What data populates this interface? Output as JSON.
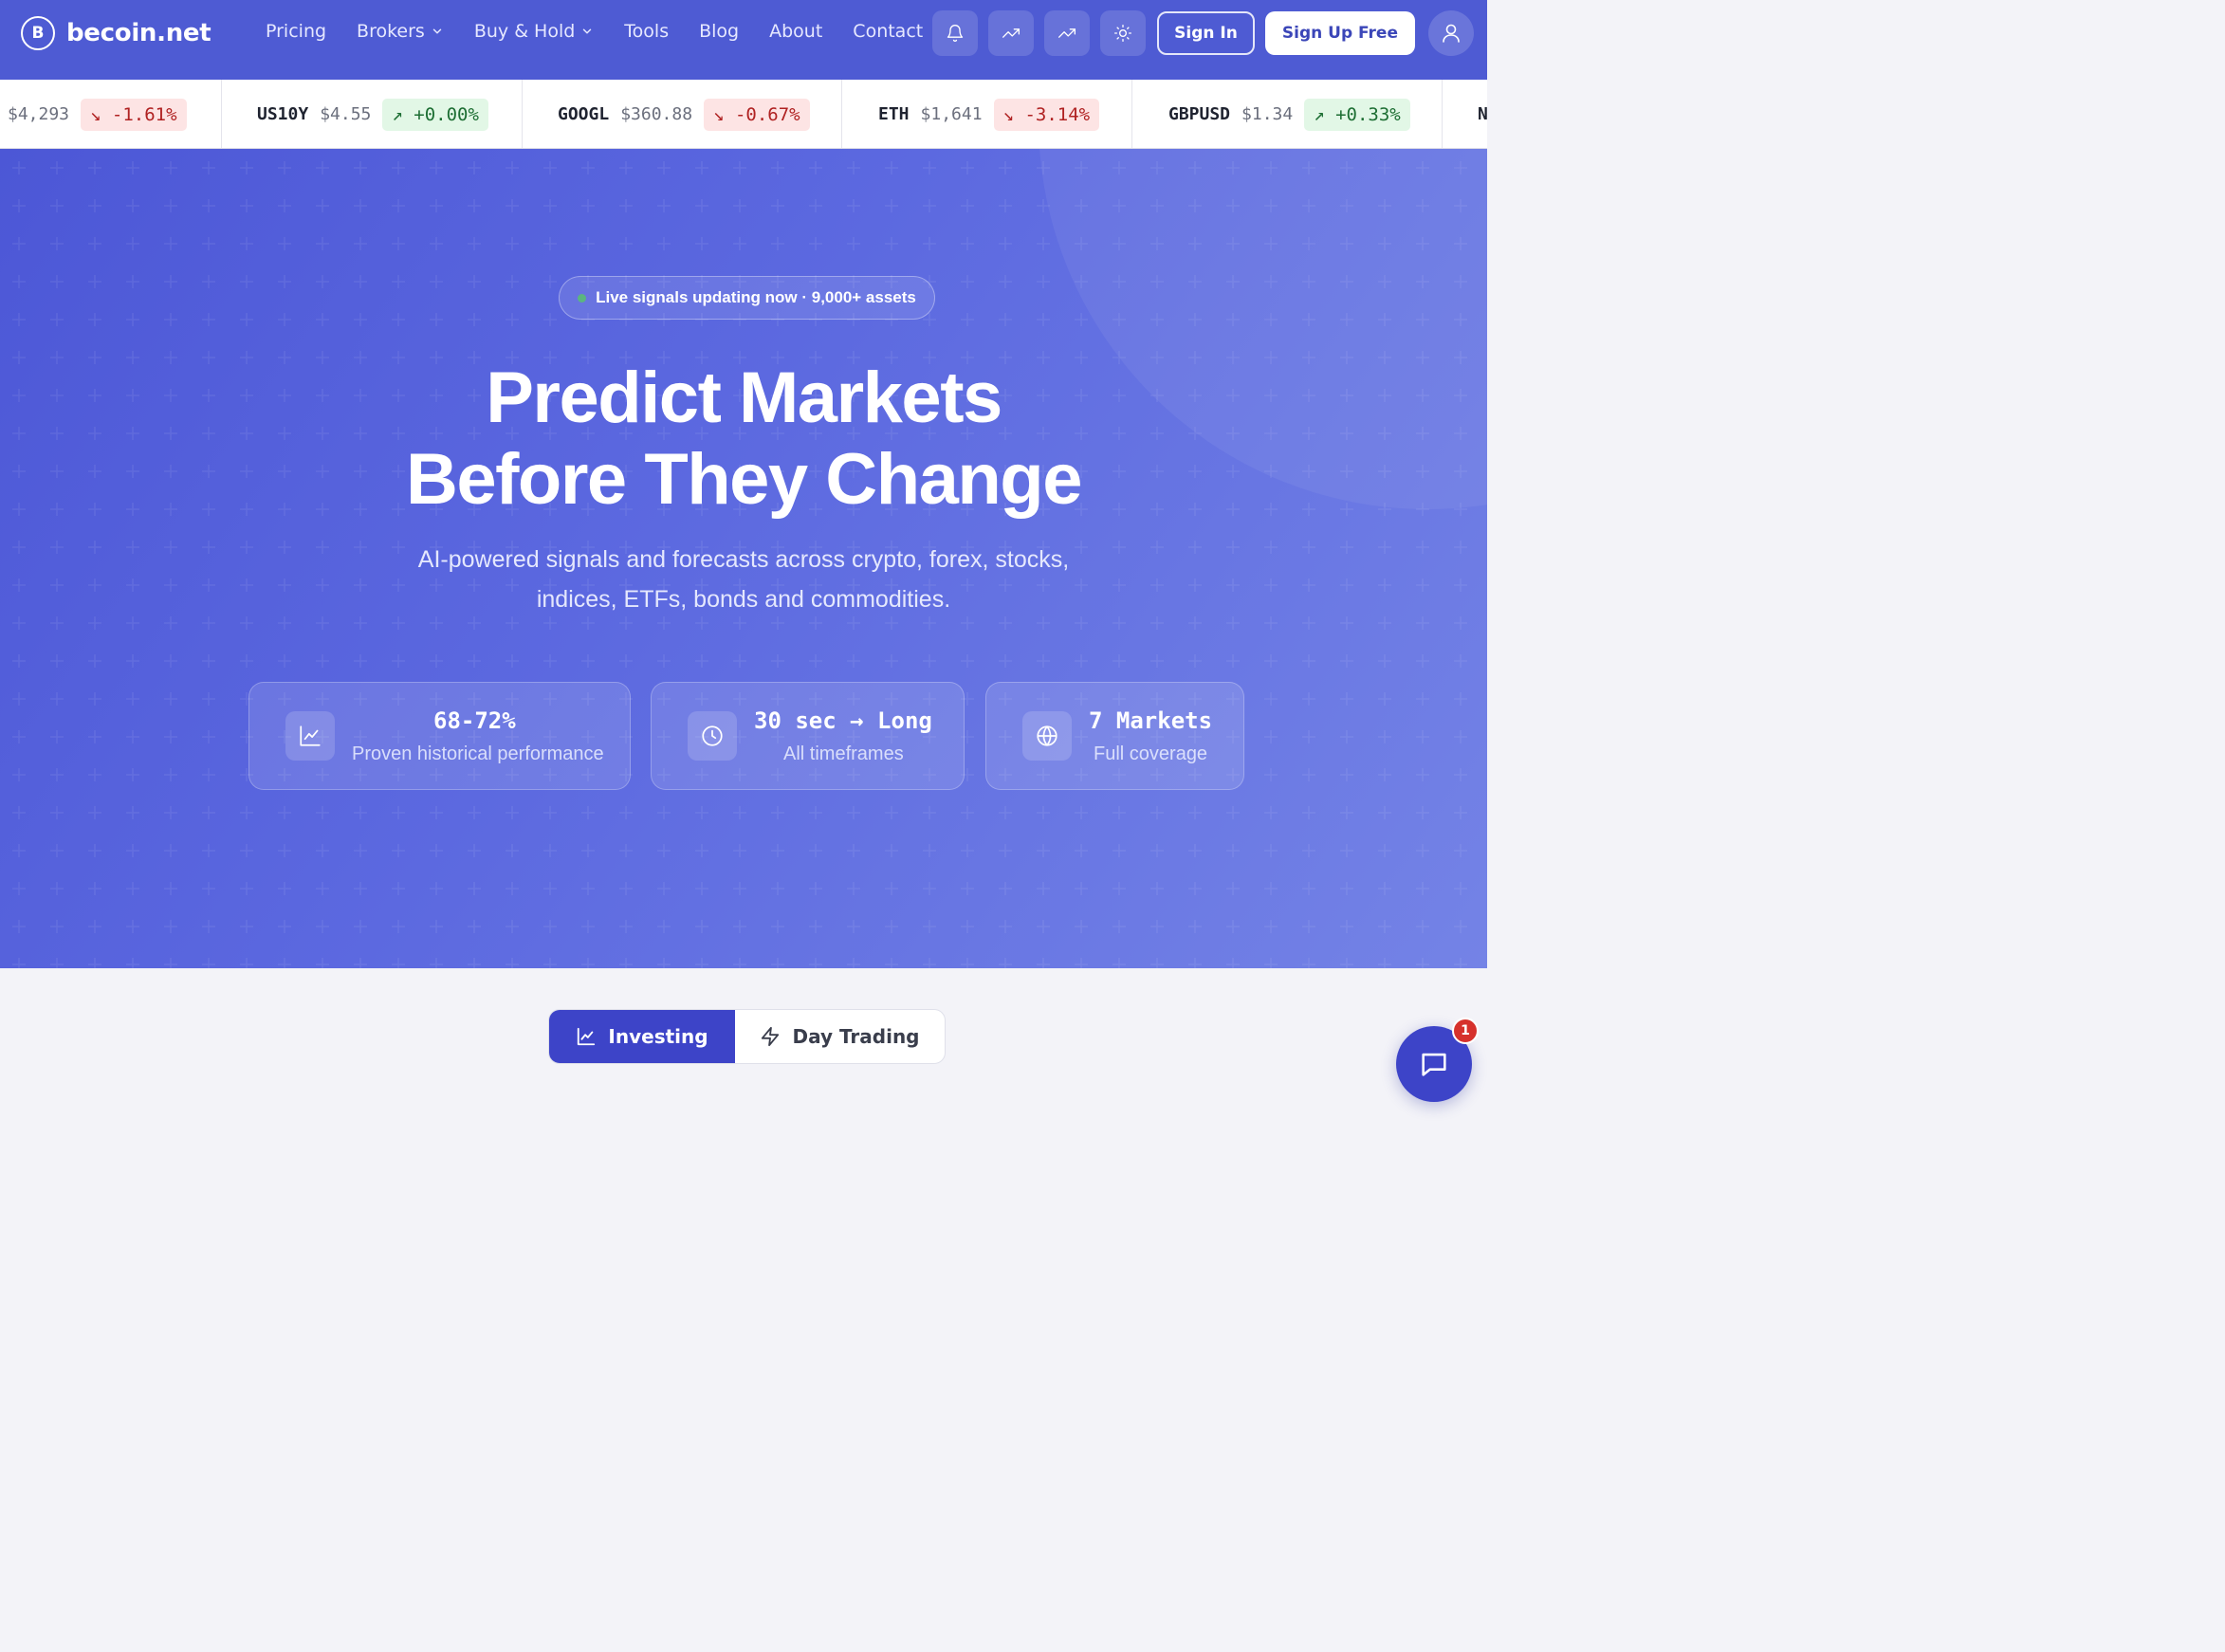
{
  "brand": {
    "logo_letter": "B",
    "name": "becoin.net"
  },
  "nav": {
    "items": [
      {
        "label": "Pricing",
        "dropdown": false
      },
      {
        "label": "Brokers",
        "dropdown": true
      },
      {
        "label": "Buy & Hold",
        "dropdown": true
      },
      {
        "label": "Tools",
        "dropdown": false
      },
      {
        "label": "Blog",
        "dropdown": false
      },
      {
        "label": "About",
        "dropdown": false
      },
      {
        "label": "Contact",
        "dropdown": false
      }
    ],
    "icon_buttons": [
      "bell-icon",
      "trending-up-icon",
      "trending-up-icon",
      "sun-icon"
    ],
    "sign_in": "Sign In",
    "sign_up": "Sign Up Free"
  },
  "ticker": [
    {
      "symbol": "",
      "price": "$4,293",
      "change": "-1.61%",
      "dir": "down"
    },
    {
      "symbol": "US10Y",
      "price": "$4.55",
      "change": "+0.00%",
      "dir": "up"
    },
    {
      "symbol": "GOOGL",
      "price": "$360.88",
      "change": "-0.67%",
      "dir": "down"
    },
    {
      "symbol": "ETH",
      "price": "$1,641",
      "change": "-3.14%",
      "dir": "down"
    },
    {
      "symbol": "GBPUSD",
      "price": "$1.34",
      "change": "+0.33%",
      "dir": "up"
    },
    {
      "symbol": "N",
      "price": "",
      "change": "",
      "dir": ""
    }
  ],
  "hero": {
    "badge": "Live signals updating now · 9,000+ assets",
    "headline_line1": "Predict Markets",
    "headline_line2": "Before They Change",
    "sub_line1": "AI-powered signals and forecasts across crypto, forex, stocks,",
    "sub_line2": "indices, ETFs, bonds and commodities.",
    "stats": [
      {
        "value": "68-72%",
        "label": "Proven historical performance",
        "icon": "chart-line-icon"
      },
      {
        "value": "30 sec → Long",
        "label": "All timeframes",
        "icon": "clock-icon"
      },
      {
        "value": "7 Markets",
        "label": "Full coverage",
        "icon": "globe-icon"
      }
    ]
  },
  "tabs": {
    "investing": "Investing",
    "day_trading": "Day Trading",
    "active": "investing"
  },
  "chat": {
    "badge_count": "1"
  },
  "colors": {
    "nav_bg": "#4e5bd3",
    "accent": "#3d44c8",
    "down": "#b02222",
    "up": "#1d6e33"
  }
}
